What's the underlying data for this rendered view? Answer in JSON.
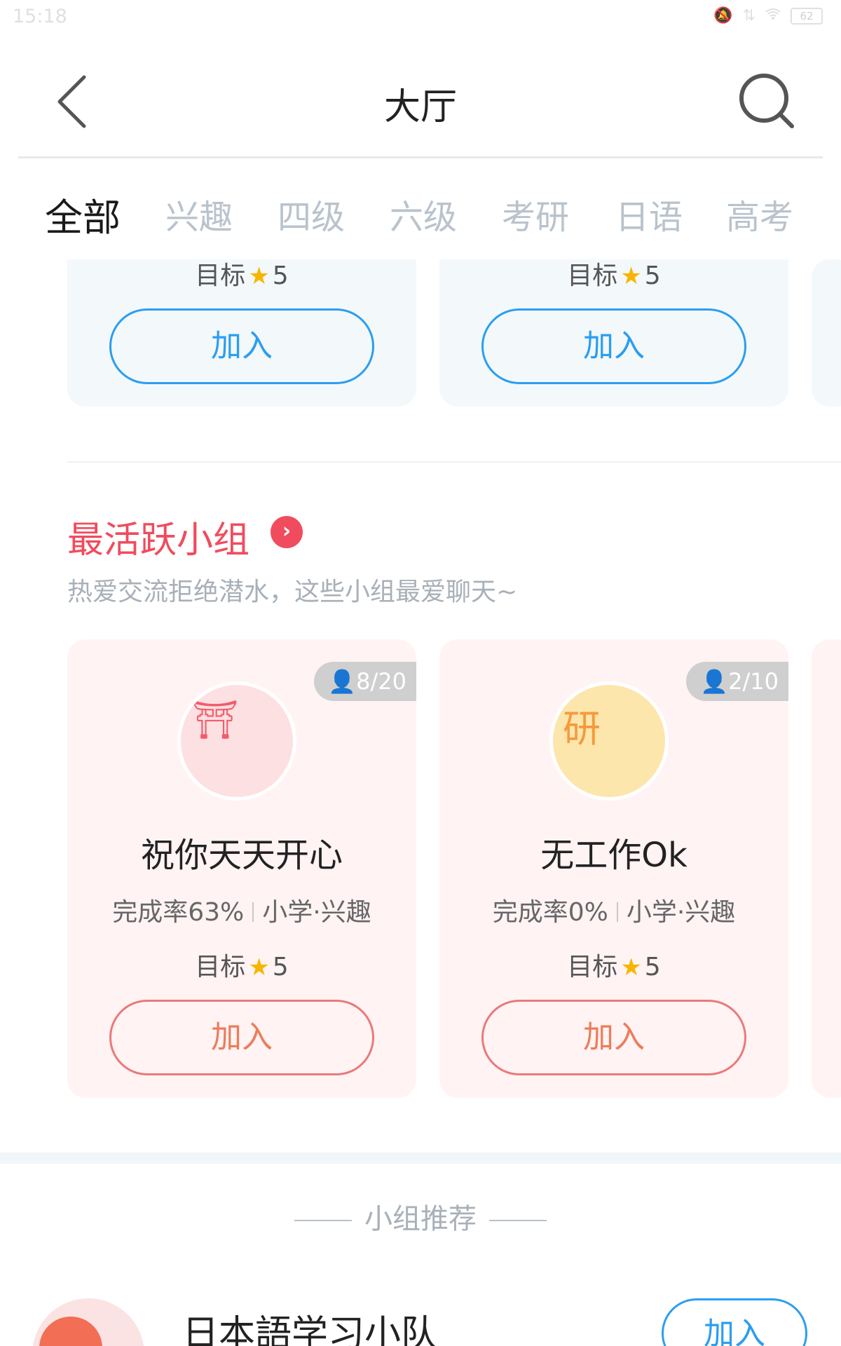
{
  "status_bar": {
    "time": "15:18",
    "battery": "62"
  },
  "header": {
    "title": "大厅"
  },
  "tabs": [
    {
      "label": "全部",
      "active": true
    },
    {
      "label": "兴趣",
      "active": false
    },
    {
      "label": "四级",
      "active": false
    },
    {
      "label": "六级",
      "active": false
    },
    {
      "label": "考研",
      "active": false
    },
    {
      "label": "日语",
      "active": false
    },
    {
      "label": "高考",
      "active": false
    }
  ],
  "top_cards": [
    {
      "target_label": "目标",
      "target_value": "5",
      "join_label": "加入"
    },
    {
      "target_label": "目标",
      "target_value": "5",
      "join_label": "加入"
    }
  ],
  "active_section": {
    "title": "最活跃小组",
    "arrow": "›",
    "subtitle": "热爱交流拒绝潜水，这些小组最爱聊天~",
    "groups": [
      {
        "members": "8/20",
        "avatar_glyph": "⛩",
        "name": "祝你天天开心",
        "completion": "完成率63%",
        "category": "小学·兴趣",
        "target_label": "目标",
        "target_value": "5",
        "join_label": "加入"
      },
      {
        "members": "2/10",
        "avatar_glyph": "研",
        "name": "无工作Ok",
        "completion": "完成率0%",
        "category": "小学·兴趣",
        "target_label": "目标",
        "target_value": "5",
        "join_label": "加入"
      }
    ]
  },
  "recommend": {
    "header": "小组推荐",
    "items": [
      {
        "name": "日本語学习小队",
        "join_label": "加入"
      }
    ]
  },
  "colors": {
    "accent_blue": "#2b9ef0",
    "accent_red": "#f04c5e",
    "join_red": "#ec7d59",
    "star": "#f7b500"
  }
}
